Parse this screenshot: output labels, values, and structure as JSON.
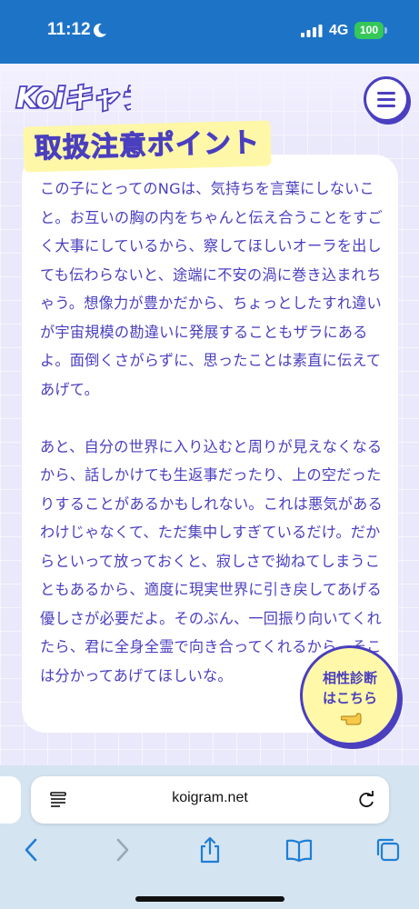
{
  "status_bar": {
    "time": "11:12",
    "network": "4G",
    "battery": "100"
  },
  "header": {
    "logo_text": "Koiキャラ"
  },
  "section": {
    "heading": "取扱注意ポイント",
    "paragraphs": [
      "この子にとってのNGは、気持ちを言葉にしないこと。お互いの胸の内をちゃんと伝え合うことをすごく大事にしているから、察してほしいオーラを出しても伝わらないと、途端に不安の渦に巻き込まれちゃう。想像力が豊かだから、ちょっとしたすれ違いが宇宙規模の勘違いに発展することもザラにあるよ。面倒くさがらずに、思ったことは素直に伝えてあげて。",
      "あと、自分の世界に入り込むと周りが見えなくなるから、話しかけても生返事だったり、上の空だったりすることがあるかもしれない。これは悪気があるわけじゃなくて、ただ集中しすぎているだけ。だからといって放っておくと、寂しさで拗ねてしまうこともあるから、適度に現実世界に引き戻してあげる優しさが必要だよ。そのぶん、一回振り向いてくれたら、君に全身全霊で向き合ってくれるから、そこは分かってあげてほしいな。"
    ]
  },
  "floating_button": {
    "line1": "相性診断",
    "line2": "はこちら"
  },
  "browser": {
    "url": "koigram.net"
  },
  "colors": {
    "status_bar": "#1d74c7",
    "accent": "#4a3fbf",
    "highlight": "#fff7a8",
    "page_bg": "#eae9fb"
  }
}
